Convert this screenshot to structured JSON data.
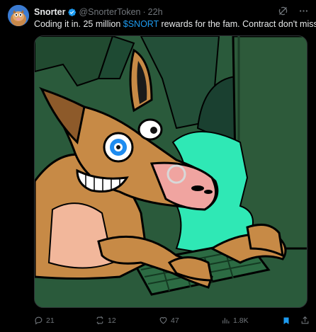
{
  "post": {
    "author_name": "Snorter",
    "handle": "@SnorterToken",
    "separator": "·",
    "time": "22h",
    "text_before": "Coding it in. 25 million ",
    "cashtag": "$SNORT",
    "text_after": " rewards for the fam. Contract don't miss."
  },
  "actions": {
    "replies": "21",
    "reposts": "12",
    "likes": "47",
    "views": "1.8K"
  },
  "colors": {
    "background": "#000000",
    "text": "#e7e9ea",
    "muted": "#71767b",
    "accent": "#1d9bf0",
    "verified": "#1d9bf0"
  },
  "icons": {
    "verified": "verified-badge-icon",
    "grok": "grok-icon",
    "more": "more-icon",
    "reply": "reply-icon",
    "repost": "repost-icon",
    "like": "heart-icon",
    "views": "views-icon",
    "bookmark": "bookmark-icon",
    "share": "share-icon"
  }
}
